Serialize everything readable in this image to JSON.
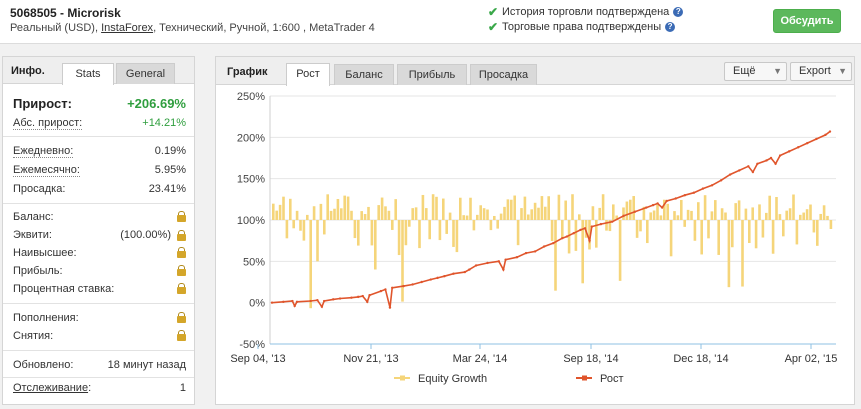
{
  "header": {
    "account_title": "5068505 - Microrisk",
    "info_prefix": "Реальный (USD),",
    "broker": "InstaForex",
    "info_suffix": ", Технический, Ручной, 1:600 , MetaTrader 4",
    "verify_history": "История торговли подтверждена",
    "verify_rights": "Торговые права подтверждены",
    "discuss_label": "Обсудить"
  },
  "left_panel": {
    "title": "Инфо.",
    "tabs": [
      "Stats",
      "General"
    ],
    "growth_label": "Прирост:",
    "growth_value": "+206.69%",
    "abs_label": "Абс. прирост:",
    "abs_value": "+14.21%",
    "daily_label": "Ежедневно:",
    "daily_value": "0.19%",
    "monthly_label": "Ежемесячно:",
    "monthly_value": "5.95%",
    "drawdown_label": "Просадка:",
    "drawdown_value": "23.41%",
    "balance_label": "Баланс:",
    "equity_label": "Эквити:",
    "equity_value": "(100.00%)",
    "highest_label": "Наивысшее:",
    "profit_label": "Прибыль:",
    "interest_label": "Процентная ставка:",
    "deposits_label": "Пополнения:",
    "withdrawals_label": "Снятия:",
    "updated_label": "Обновлено:",
    "updated_value": "18 минут назад",
    "tracking_label": "Отслеживание",
    "tracking_colon": ":",
    "tracking_value": "1"
  },
  "chart_panel": {
    "title": "График",
    "tabs": [
      "Рост",
      "Баланс",
      "Прибыль",
      "Просадка"
    ],
    "dropdown_more": "Ещё",
    "dropdown_export": "Export"
  },
  "chart_data": {
    "type": "line",
    "y_ticks": [
      "250%",
      "200%",
      "150%",
      "100%",
      "50%",
      "0%",
      "-50%"
    ],
    "ylim": [
      -50,
      250
    ],
    "x_ticks": [
      "Sep 04, '13",
      "Nov 21, '13",
      "Mar 24, '14",
      "Sep 18, '14",
      "Dec 18, '14",
      "Apr 02, '15"
    ],
    "grid": true,
    "legend_position": "bottom",
    "series": [
      {
        "name": "Equity Growth",
        "color": "#f5d57a",
        "kind": "bar",
        "baseline": 100
      },
      {
        "name": "Рост",
        "color": "#e0552c",
        "kind": "line",
        "points": [
          [
            0,
            0
          ],
          [
            0.05,
            1
          ],
          [
            0.09,
            2
          ],
          [
            0.1,
            -4
          ],
          [
            0.11,
            1
          ],
          [
            0.17,
            2
          ],
          [
            0.2,
            3
          ],
          [
            0.22,
            -5
          ],
          [
            0.23,
            2
          ],
          [
            0.27,
            4
          ],
          [
            0.3,
            5
          ],
          [
            0.35,
            6
          ],
          [
            0.38,
            7
          ],
          [
            0.4,
            8
          ],
          [
            0.42,
            1
          ],
          [
            0.43,
            9
          ],
          [
            0.48,
            14
          ],
          [
            0.5,
            16
          ],
          [
            0.52,
            -6
          ],
          [
            0.53,
            18
          ],
          [
            0.58,
            20
          ],
          [
            0.62,
            22
          ],
          [
            0.66,
            25
          ],
          [
            0.7,
            28
          ],
          [
            0.73,
            30
          ],
          [
            0.76,
            32
          ],
          [
            0.8,
            35
          ],
          [
            0.85,
            37
          ],
          [
            0.87,
            40
          ],
          [
            0.9,
            45
          ],
          [
            0.95,
            48
          ],
          [
            1.0,
            50
          ],
          [
            1.02,
            40
          ],
          [
            1.03,
            52
          ],
          [
            1.08,
            55
          ],
          [
            1.12,
            60
          ],
          [
            1.16,
            62
          ],
          [
            1.2,
            68
          ],
          [
            1.24,
            72
          ],
          [
            1.28,
            78
          ],
          [
            1.3,
            80
          ],
          [
            1.33,
            84
          ],
          [
            1.36,
            88
          ],
          [
            1.38,
            90
          ],
          [
            1.4,
            75
          ],
          [
            1.41,
            92
          ],
          [
            1.45,
            95
          ],
          [
            1.5,
            98
          ],
          [
            1.55,
            105
          ],
          [
            1.6,
            110
          ],
          [
            1.65,
            115
          ],
          [
            1.68,
            118
          ],
          [
            1.7,
            120
          ],
          [
            1.72,
            115
          ],
          [
            1.74,
            123
          ],
          [
            1.78,
            126
          ],
          [
            1.82,
            130
          ],
          [
            1.86,
            133
          ],
          [
            1.9,
            138
          ],
          [
            1.94,
            142
          ],
          [
            1.98,
            148
          ],
          [
            2.02,
            155
          ],
          [
            2.06,
            160
          ],
          [
            2.1,
            165
          ],
          [
            2.12,
            158
          ],
          [
            2.14,
            168
          ],
          [
            2.18,
            172
          ],
          [
            2.2,
            175
          ],
          [
            2.22,
            168
          ],
          [
            2.24,
            178
          ],
          [
            2.28,
            183
          ],
          [
            2.32,
            188
          ],
          [
            2.36,
            193
          ],
          [
            2.4,
            198
          ],
          [
            2.44,
            203
          ],
          [
            2.46,
            207
          ]
        ]
      }
    ]
  }
}
